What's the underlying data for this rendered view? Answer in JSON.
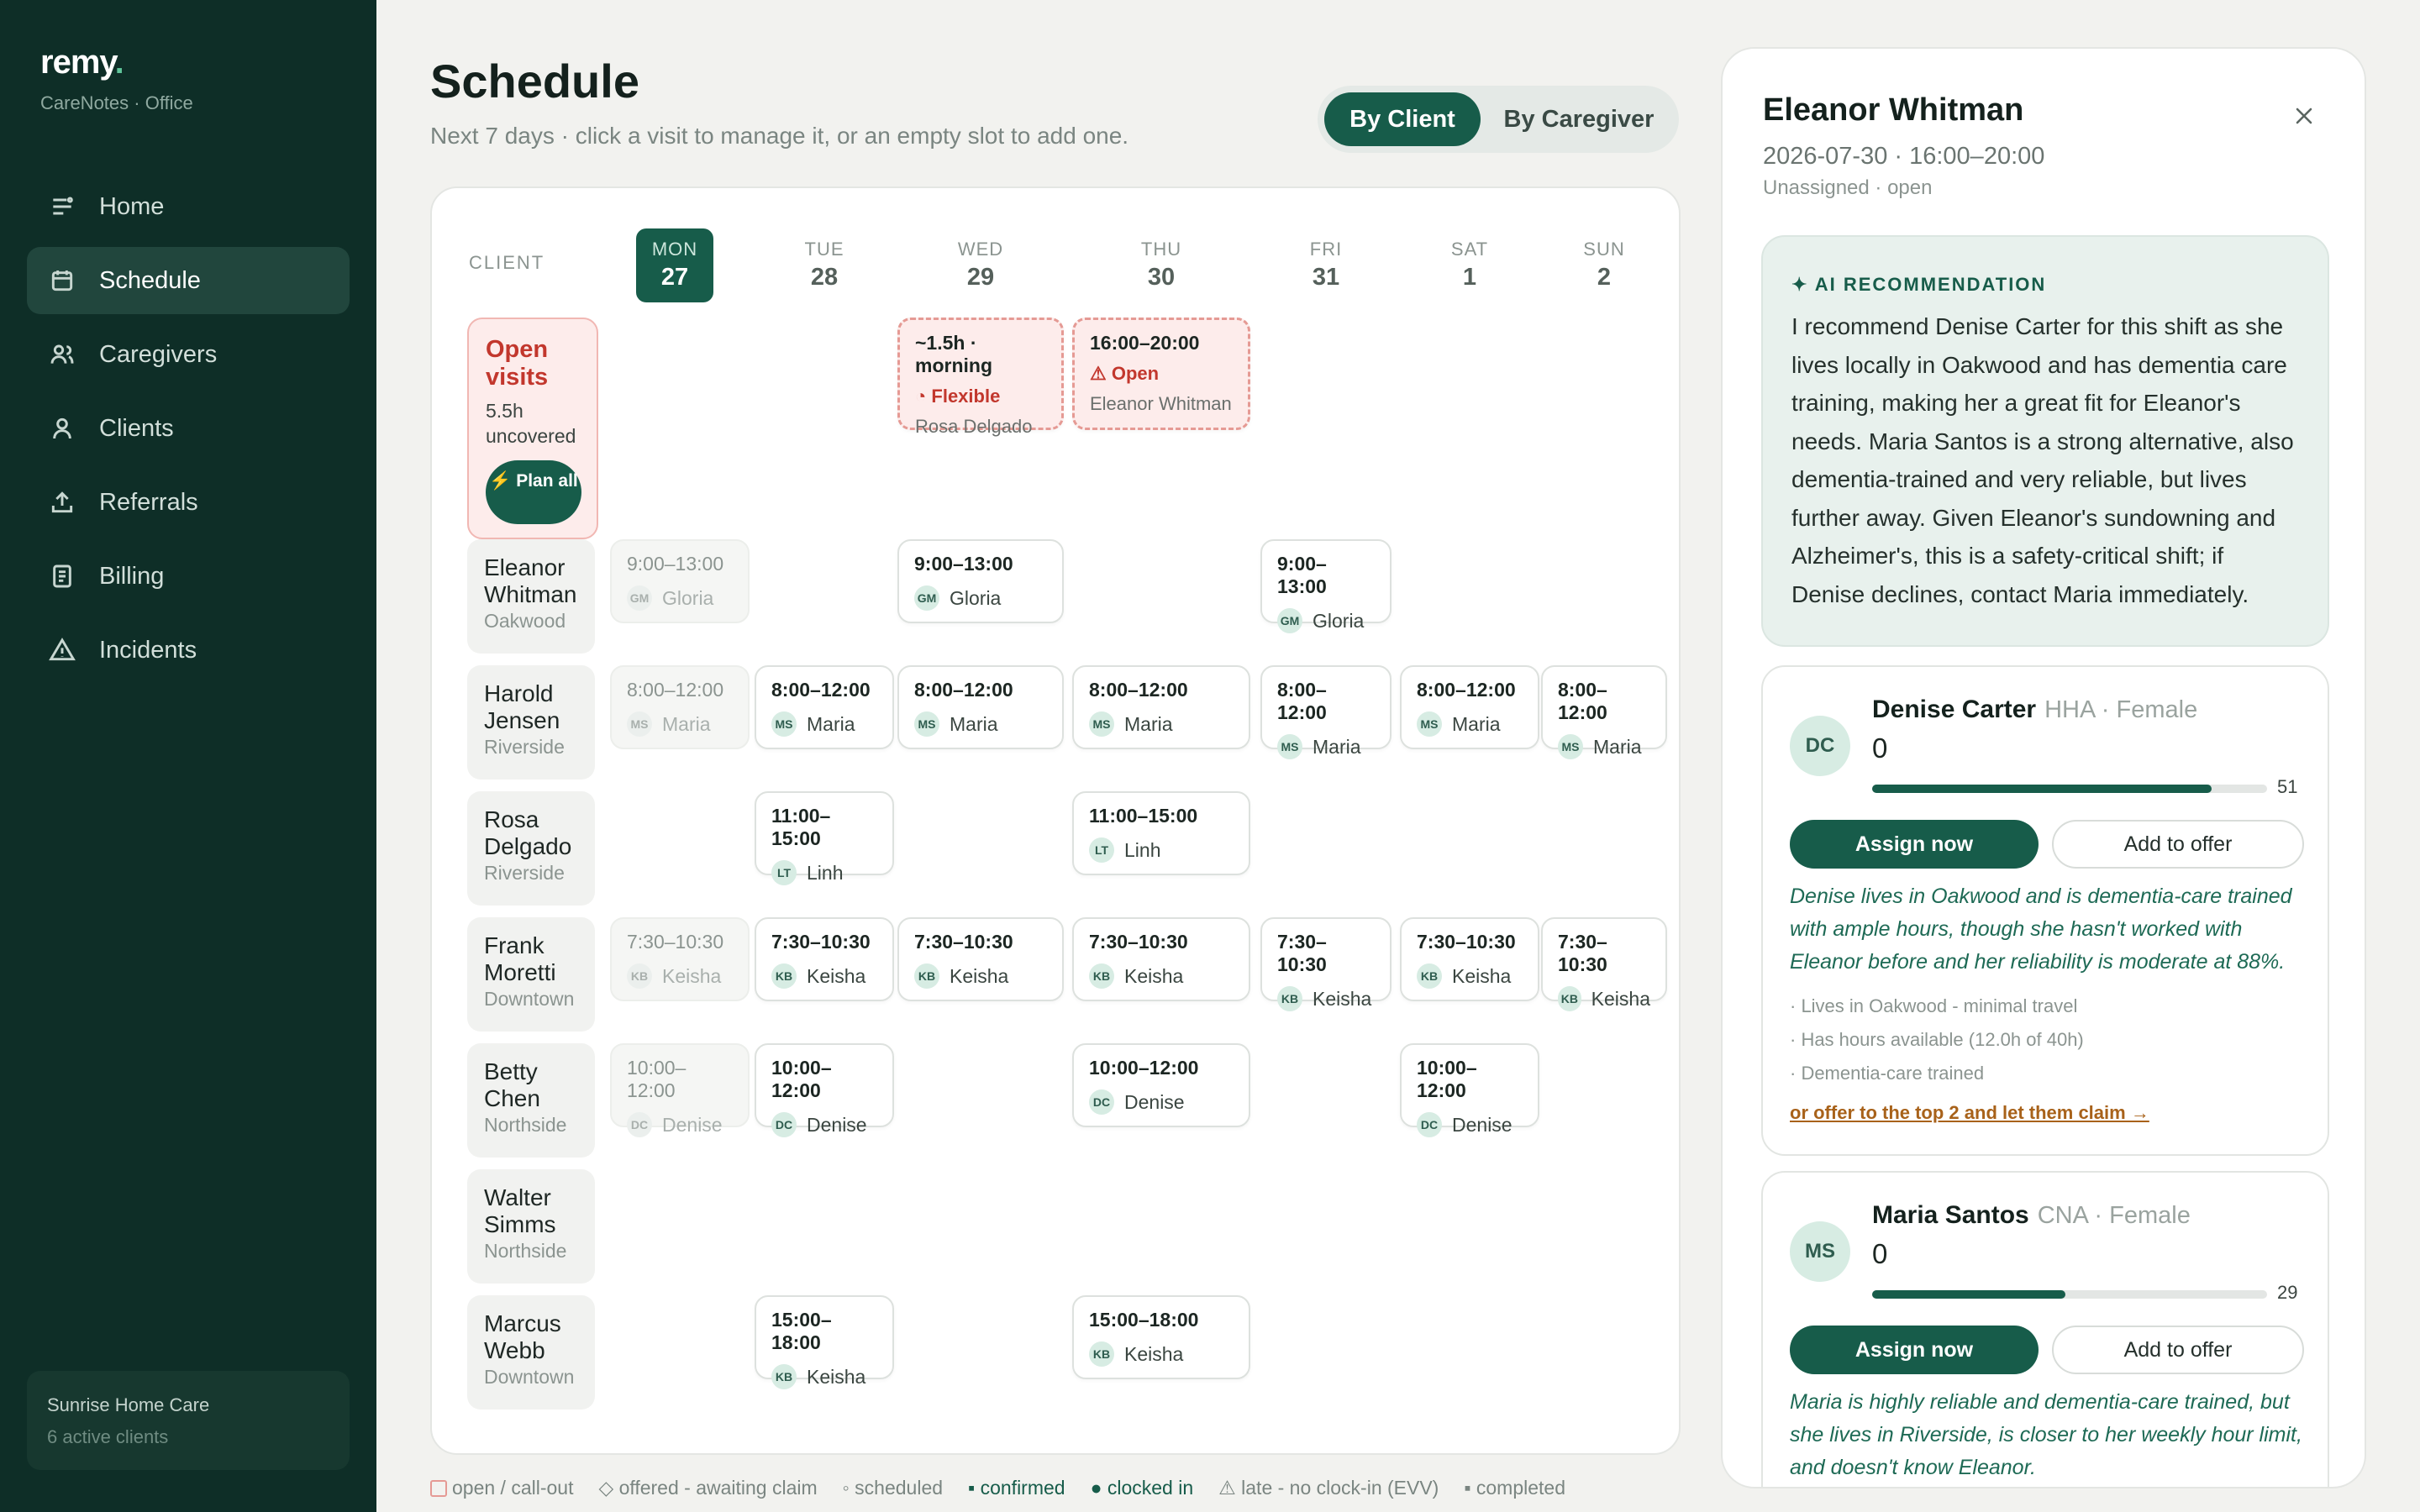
{
  "app": {
    "logo": "remy",
    "logo_dot": ".",
    "subtitle": "CareNotes · Office"
  },
  "nav": [
    {
      "label": "Home",
      "icon": "home-icon"
    },
    {
      "label": "Schedule",
      "icon": "calendar-icon",
      "active": true
    },
    {
      "label": "Caregivers",
      "icon": "users-icon"
    },
    {
      "label": "Clients",
      "icon": "user-icon"
    },
    {
      "label": "Referrals",
      "icon": "upload-icon"
    },
    {
      "label": "Billing",
      "icon": "document-icon"
    },
    {
      "label": "Incidents",
      "icon": "warning-icon"
    }
  ],
  "org": {
    "name": "Sunrise Home Care",
    "sub": "6 active clients"
  },
  "page": {
    "title": "Schedule",
    "subtitle": "Next 7 days · click a visit to manage it, or an empty slot to add one."
  },
  "toggle": {
    "on": "By Client",
    "off": "By Caregiver"
  },
  "board": {
    "client_header": "CLIENT",
    "days": [
      {
        "d": "MON",
        "n": "27",
        "today": true
      },
      {
        "d": "TUE",
        "n": "28"
      },
      {
        "d": "WED",
        "n": "29"
      },
      {
        "d": "THU",
        "n": "30"
      },
      {
        "d": "FRI",
        "n": "31"
      },
      {
        "d": "SAT",
        "n": "1"
      },
      {
        "d": "SUN",
        "n": "2"
      }
    ],
    "open": {
      "title": "Open visits",
      "hours": "5.5h",
      "label": "uncovered",
      "button": "⚡ Plan all"
    },
    "open_visits": [
      {
        "time": "~1.5h · morning",
        "status": "◔ Flexible",
        "client": "Rosa Delgado"
      },
      {
        "time": "16:00–20:00",
        "status": "⚠ Open",
        "client": "Eleanor Whitman"
      }
    ],
    "clients": [
      {
        "name": "Eleanor Whitman",
        "loc": "Oakwood"
      },
      {
        "name": "Harold Jensen",
        "loc": "Riverside"
      },
      {
        "name": "Rosa Delgado",
        "loc": "Riverside"
      },
      {
        "name": "Frank Moretti",
        "loc": "Downtown"
      },
      {
        "name": "Betty Chen",
        "loc": "Northside"
      },
      {
        "name": "Walter Simms",
        "loc": "Northside"
      },
      {
        "name": "Marcus Webb",
        "loc": "Downtown"
      }
    ],
    "visits": [
      {
        "row": 0,
        "day": 0,
        "time": "9:00–13:00",
        "ini": "GM",
        "who": "Gloria",
        "past": true
      },
      {
        "row": 0,
        "day": 2,
        "time": "9:00–13:00",
        "ini": "GM",
        "who": "Gloria"
      },
      {
        "row": 0,
        "day": 4,
        "time": "9:00–13:00",
        "ini": "GM",
        "who": "Gloria"
      },
      {
        "row": 1,
        "day": 0,
        "time": "8:00–12:00",
        "ini": "MS",
        "who": "Maria",
        "past": true
      },
      {
        "row": 1,
        "day": 1,
        "time": "8:00–12:00",
        "ini": "MS",
        "who": "Maria"
      },
      {
        "row": 1,
        "day": 2,
        "time": "8:00–12:00",
        "ini": "MS",
        "who": "Maria"
      },
      {
        "row": 1,
        "day": 3,
        "time": "8:00–12:00",
        "ini": "MS",
        "who": "Maria"
      },
      {
        "row": 1,
        "day": 4,
        "time": "8:00–12:00",
        "ini": "MS",
        "who": "Maria"
      },
      {
        "row": 1,
        "day": 5,
        "time": "8:00–12:00",
        "ini": "MS",
        "who": "Maria"
      },
      {
        "row": 1,
        "day": 6,
        "time": "8:00–12:00",
        "ini": "MS",
        "who": "Maria"
      },
      {
        "row": 2,
        "day": 1,
        "time": "11:00–15:00",
        "ini": "LT",
        "who": "Linh"
      },
      {
        "row": 2,
        "day": 3,
        "time": "11:00–15:00",
        "ini": "LT",
        "who": "Linh"
      },
      {
        "row": 3,
        "day": 0,
        "time": "7:30–10:30",
        "ini": "KB",
        "who": "Keisha",
        "past": true
      },
      {
        "row": 3,
        "day": 1,
        "time": "7:30–10:30",
        "ini": "KB",
        "who": "Keisha"
      },
      {
        "row": 3,
        "day": 2,
        "time": "7:30–10:30",
        "ini": "KB",
        "who": "Keisha"
      },
      {
        "row": 3,
        "day": 3,
        "time": "7:30–10:30",
        "ini": "KB",
        "who": "Keisha"
      },
      {
        "row": 3,
        "day": 4,
        "time": "7:30–10:30",
        "ini": "KB",
        "who": "Keisha"
      },
      {
        "row": 3,
        "day": 5,
        "time": "7:30–10:30",
        "ini": "KB",
        "who": "Keisha"
      },
      {
        "row": 3,
        "day": 6,
        "time": "7:30–10:30",
        "ini": "KB",
        "who": "Keisha"
      },
      {
        "row": 4,
        "day": 0,
        "time": "10:00–12:00",
        "ini": "DC",
        "who": "Denise",
        "past": true
      },
      {
        "row": 4,
        "day": 1,
        "time": "10:00–12:00",
        "ini": "DC",
        "who": "Denise"
      },
      {
        "row": 4,
        "day": 3,
        "time": "10:00–12:00",
        "ini": "DC",
        "who": "Denise"
      },
      {
        "row": 4,
        "day": 5,
        "time": "10:00–12:00",
        "ini": "DC",
        "who": "Denise"
      },
      {
        "row": 6,
        "day": 1,
        "time": "15:00–18:00",
        "ini": "KB",
        "who": "Keisha"
      },
      {
        "row": 6,
        "day": 3,
        "time": "15:00–18:00",
        "ini": "KB",
        "who": "Keisha"
      }
    ]
  },
  "legend": [
    {
      "label": "open / call-out",
      "style": "open"
    },
    {
      "label": "◇ offered - awaiting claim",
      "style": "plain"
    },
    {
      "label": "◦ scheduled",
      "style": "plain"
    },
    {
      "label": "▪ confirmed",
      "style": "green"
    },
    {
      "label": "● clocked in",
      "style": "green"
    },
    {
      "label": "⚠ late - no clock-in (EVV)",
      "style": "plain"
    },
    {
      "label": "▪ completed",
      "style": "plain"
    }
  ],
  "panel": {
    "name": "Eleanor Whitman",
    "date": "2026-07-30 · 16:00–20:00",
    "status": "Unassigned · open",
    "ai_label": "✦ AI RECOMMENDATION",
    "ai_text": "I recommend Denise Carter for this shift as she lives locally in Oakwood and has dementia care training, making her a great fit for Eleanor's needs. Maria Santos is a strong alternative, also dementia-trained and very reliable, but lives further away. Given Eleanor's sundowning and Alzheimer's, this is a safety-critical shift; if Denise declines, contact Maria immediately.",
    "candidates": [
      {
        "ini": "DC",
        "name": "Denise Carter",
        "role": "HHA · Female",
        "score": "0",
        "bar_value": "51",
        "bar_fraction": 0.86,
        "assign": "Assign now",
        "offer": "Add to offer",
        "reason": "Denise lives in Oakwood and is dementia-care trained with ample hours, though she hasn't worked with Eleanor before and her reliability is moderate at 88%.",
        "bullets": [
          "· Lives in Oakwood - minimal travel",
          "· Has hours available (12.0h of 40h)",
          "· Dementia-care trained"
        ],
        "link": "or offer to the top 2 and let them claim →"
      },
      {
        "ini": "MS",
        "name": "Maria Santos",
        "role": "CNA · Female",
        "score": "0",
        "bar_value": "29",
        "bar_fraction": 0.49,
        "assign": "Assign now",
        "offer": "Add to offer",
        "reason": "Maria is highly reliable and dementia-care trained, but she lives in Riverside, is closer to her weekly hour limit, and doesn't know Eleanor."
      }
    ]
  }
}
